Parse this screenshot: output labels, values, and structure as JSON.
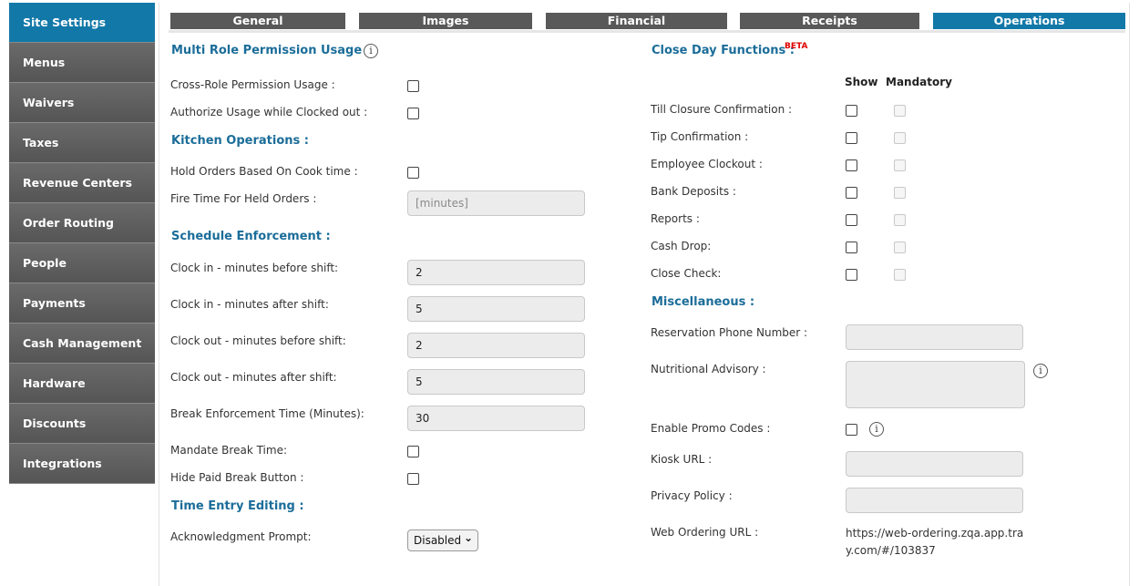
{
  "sidebar": {
    "items": [
      {
        "label": "Site Settings"
      },
      {
        "label": "Menus"
      },
      {
        "label": "Waivers"
      },
      {
        "label": "Taxes"
      },
      {
        "label": "Revenue Centers"
      },
      {
        "label": "Order Routing"
      },
      {
        "label": "People"
      },
      {
        "label": "Payments"
      },
      {
        "label": "Cash Management"
      },
      {
        "label": "Hardware"
      },
      {
        "label": "Discounts"
      },
      {
        "label": "Integrations"
      }
    ]
  },
  "tabs": [
    "General",
    "Images",
    "Financial",
    "Receipts",
    "Operations"
  ],
  "left": {
    "multi_role": {
      "heading": "Multi Role Permission Usage :",
      "info_icon": "i",
      "cross_role": "Cross-Role Permission Usage :",
      "authorize_clocked_out": "Authorize Usage while Clocked out :"
    },
    "kitchen": {
      "heading": "Kitchen Operations :",
      "hold_orders": "Hold Orders Based On Cook time :",
      "fire_time": "Fire Time For Held Orders :",
      "fire_time_placeholder": "[minutes]"
    },
    "schedule": {
      "heading": "Schedule Enforcement :",
      "clock_in_before": "Clock in - minutes before shift:",
      "clock_in_before_value": "2",
      "clock_in_after": "Clock in - minutes after shift:",
      "clock_in_after_value": "5",
      "clock_out_before": "Clock out - minutes before shift:",
      "clock_out_before_value": "2",
      "clock_out_after": "Clock out - minutes after shift:",
      "clock_out_after_value": "5",
      "break_time": "Break Enforcement Time (Minutes):",
      "break_time_value": "30",
      "mandate_break": "Mandate Break Time:",
      "hide_paid_break": "Hide Paid Break Button :"
    },
    "time_entry": {
      "heading": "Time Entry Editing :",
      "ack_prompt": "Acknowledgment Prompt:",
      "ack_value": "Disabled",
      "chevron": "⌄"
    }
  },
  "right": {
    "close_day": {
      "heading": "Close Day Functions :",
      "beta": "BETA",
      "col_show": "Show",
      "col_mandatory": "Mandatory",
      "rows": [
        "Till Closure Confirmation :",
        "Tip Confirmation :",
        "Employee Clockout :",
        "Bank Deposits :",
        "Reports :",
        "Cash Drop:",
        "Close Check:"
      ]
    },
    "misc": {
      "heading": "Miscellaneous :",
      "reservation_phone": "Reservation Phone Number :",
      "nutritional_advisory": "Nutritional Advisory :",
      "enable_promo": "Enable Promo Codes :",
      "kiosk_url": "Kiosk URL :",
      "privacy_policy": "Privacy Policy :",
      "web_ordering_url": "Web Ordering URL :",
      "web_ordering_value": "https://web-ordering.zqa.app.tray.com/#/103837",
      "info_icon": "i"
    }
  }
}
